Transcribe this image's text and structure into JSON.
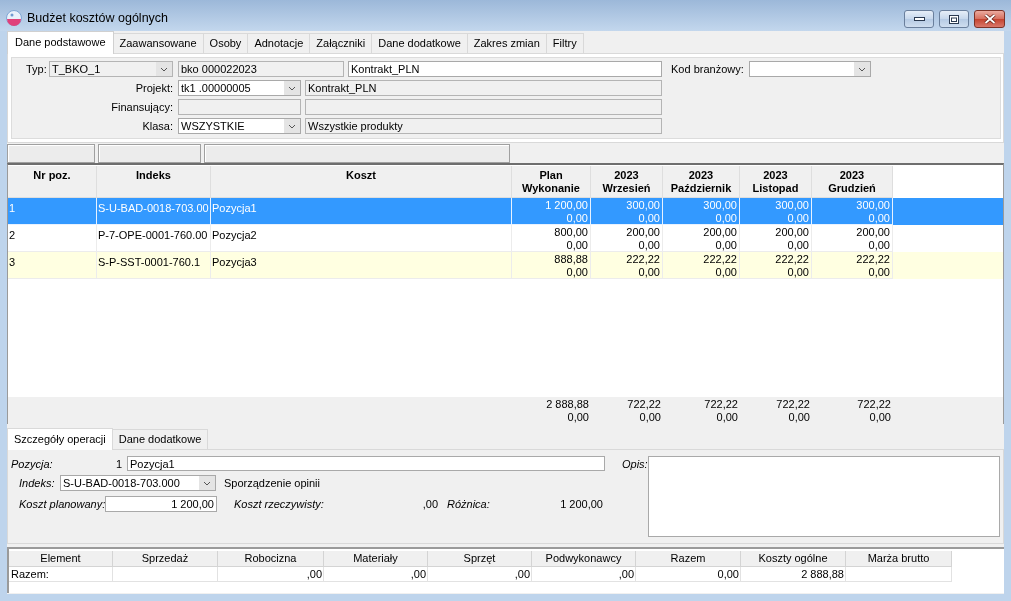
{
  "window": {
    "title": "Budżet kosztów ogólnych"
  },
  "tabs": [
    {
      "label": "Dane podstawowe",
      "selected": true
    },
    {
      "label": "Zaawansowane",
      "selected": false
    },
    {
      "label": "Osoby",
      "selected": false
    },
    {
      "label": "Adnotacje",
      "selected": false
    },
    {
      "label": "Załączniki",
      "selected": false
    },
    {
      "label": "Dane dodatkowe",
      "selected": false
    },
    {
      "label": "Zakres zmian",
      "selected": false
    },
    {
      "label": "Filtry",
      "selected": false
    }
  ],
  "form": {
    "type": {
      "label": "Typ:",
      "value": "T_BKO_1",
      "readonly": true
    },
    "number": {
      "value": "bko 000022023",
      "readonly": true
    },
    "name": {
      "value": "Kontrakt_PLN",
      "readonly": false
    },
    "industry_code": {
      "label": "Kod branżowy:",
      "readonly": false
    },
    "rows": [
      {
        "label": "Projekt:",
        "field": {
          "kind": "combo",
          "value": "tk1 .00000005",
          "readonly": false
        },
        "description": {
          "value": "Kontrakt_PLN",
          "readonly": true
        }
      },
      {
        "label": "Finansujący:",
        "field": {
          "kind": "text",
          "readonly": true
        },
        "description": {
          "readonly": true
        }
      },
      {
        "label": "Klasa:",
        "field": {
          "kind": "combo",
          "value": "WSZYSTKIE",
          "readonly": false
        },
        "description": {
          "value": "Wszystkie produkty",
          "readonly": true
        }
      }
    ]
  },
  "table": {
    "columns": [
      {
        "lines": [
          "Nr poz."
        ]
      },
      {
        "lines": [
          "Indeks"
        ]
      },
      {
        "lines": [
          "Koszt"
        ]
      },
      {
        "lines": [
          "Plan",
          "Wykonanie"
        ]
      },
      {
        "lines": [
          "2023",
          "Wrzesień"
        ]
      },
      {
        "lines": [
          "2023",
          "Październik"
        ]
      },
      {
        "lines": [
          "2023",
          "Listopad"
        ]
      },
      {
        "lines": [
          "2023",
          "Grudzień"
        ]
      }
    ],
    "rows": [
      {
        "selected": true,
        "cells": [
          "1",
          "S-U-BAD-0018-703.00",
          "Pozycja1"
        ],
        "amounts": [
          [
            "1 200,00",
            "0,00"
          ],
          [
            "300,00",
            "0,00"
          ],
          [
            "300,00",
            "0,00"
          ],
          [
            "300,00",
            "0,00"
          ],
          [
            "300,00",
            "0,00"
          ]
        ]
      },
      {
        "selected": false,
        "cells": [
          "2",
          "P-7-OPE-0001-760.00",
          "Pozycja2"
        ],
        "amounts": [
          [
            "800,00",
            "0,00"
          ],
          [
            "200,00",
            "0,00"
          ],
          [
            "200,00",
            "0,00"
          ],
          [
            "200,00",
            "0,00"
          ],
          [
            "200,00",
            "0,00"
          ]
        ]
      },
      {
        "selected": false,
        "cells": [
          "3",
          "S-P-SST-0001-760.1",
          "Pozycja3"
        ],
        "amounts": [
          [
            "888,88",
            "0,00"
          ],
          [
            "222,22",
            "0,00"
          ],
          [
            "222,22",
            "0,00"
          ],
          [
            "222,22",
            "0,00"
          ],
          [
            "222,22",
            "0,00"
          ]
        ]
      }
    ],
    "totals": [
      [
        "2 888,88",
        "0,00"
      ],
      [
        "722,22",
        "0,00"
      ],
      [
        "722,22",
        "0,00"
      ],
      [
        "722,22",
        "0,00"
      ],
      [
        "722,22",
        "0,00"
      ]
    ]
  },
  "detail_tabs": [
    {
      "label": "Szczegóły operacji",
      "selected": true
    },
    {
      "label": "Dane dodatkowe",
      "selected": false
    }
  ],
  "details": {
    "position": {
      "label": "Pozycja:",
      "number": "1",
      "value": "Pozycja1"
    },
    "index": {
      "label": "Indeks:",
      "value": "S-U-BAD-0018-703.000",
      "description": "Sporządzenie opinii"
    },
    "planned_cost": {
      "label": "Koszt planowany:",
      "value": "1 200,00"
    },
    "actual_cost": {
      "label": "Koszt rzeczywisty:",
      "value": ",00"
    },
    "difference": {
      "label": "Różnica:",
      "value": "1 200,00"
    },
    "notes": {
      "label": "Opis:"
    }
  },
  "summary": {
    "columns": [
      "Element",
      "Sprzedaż",
      "Robocizna",
      "Materiały",
      "Sprzęt",
      "Podwykonawcy",
      "Razem",
      "Koszty ogólne",
      "Marża brutto"
    ],
    "rows": [
      [
        "Razem:",
        null,
        ",00",
        ",00",
        ",00",
        ",00",
        "0,00",
        "2 888,88",
        null
      ]
    ]
  }
}
